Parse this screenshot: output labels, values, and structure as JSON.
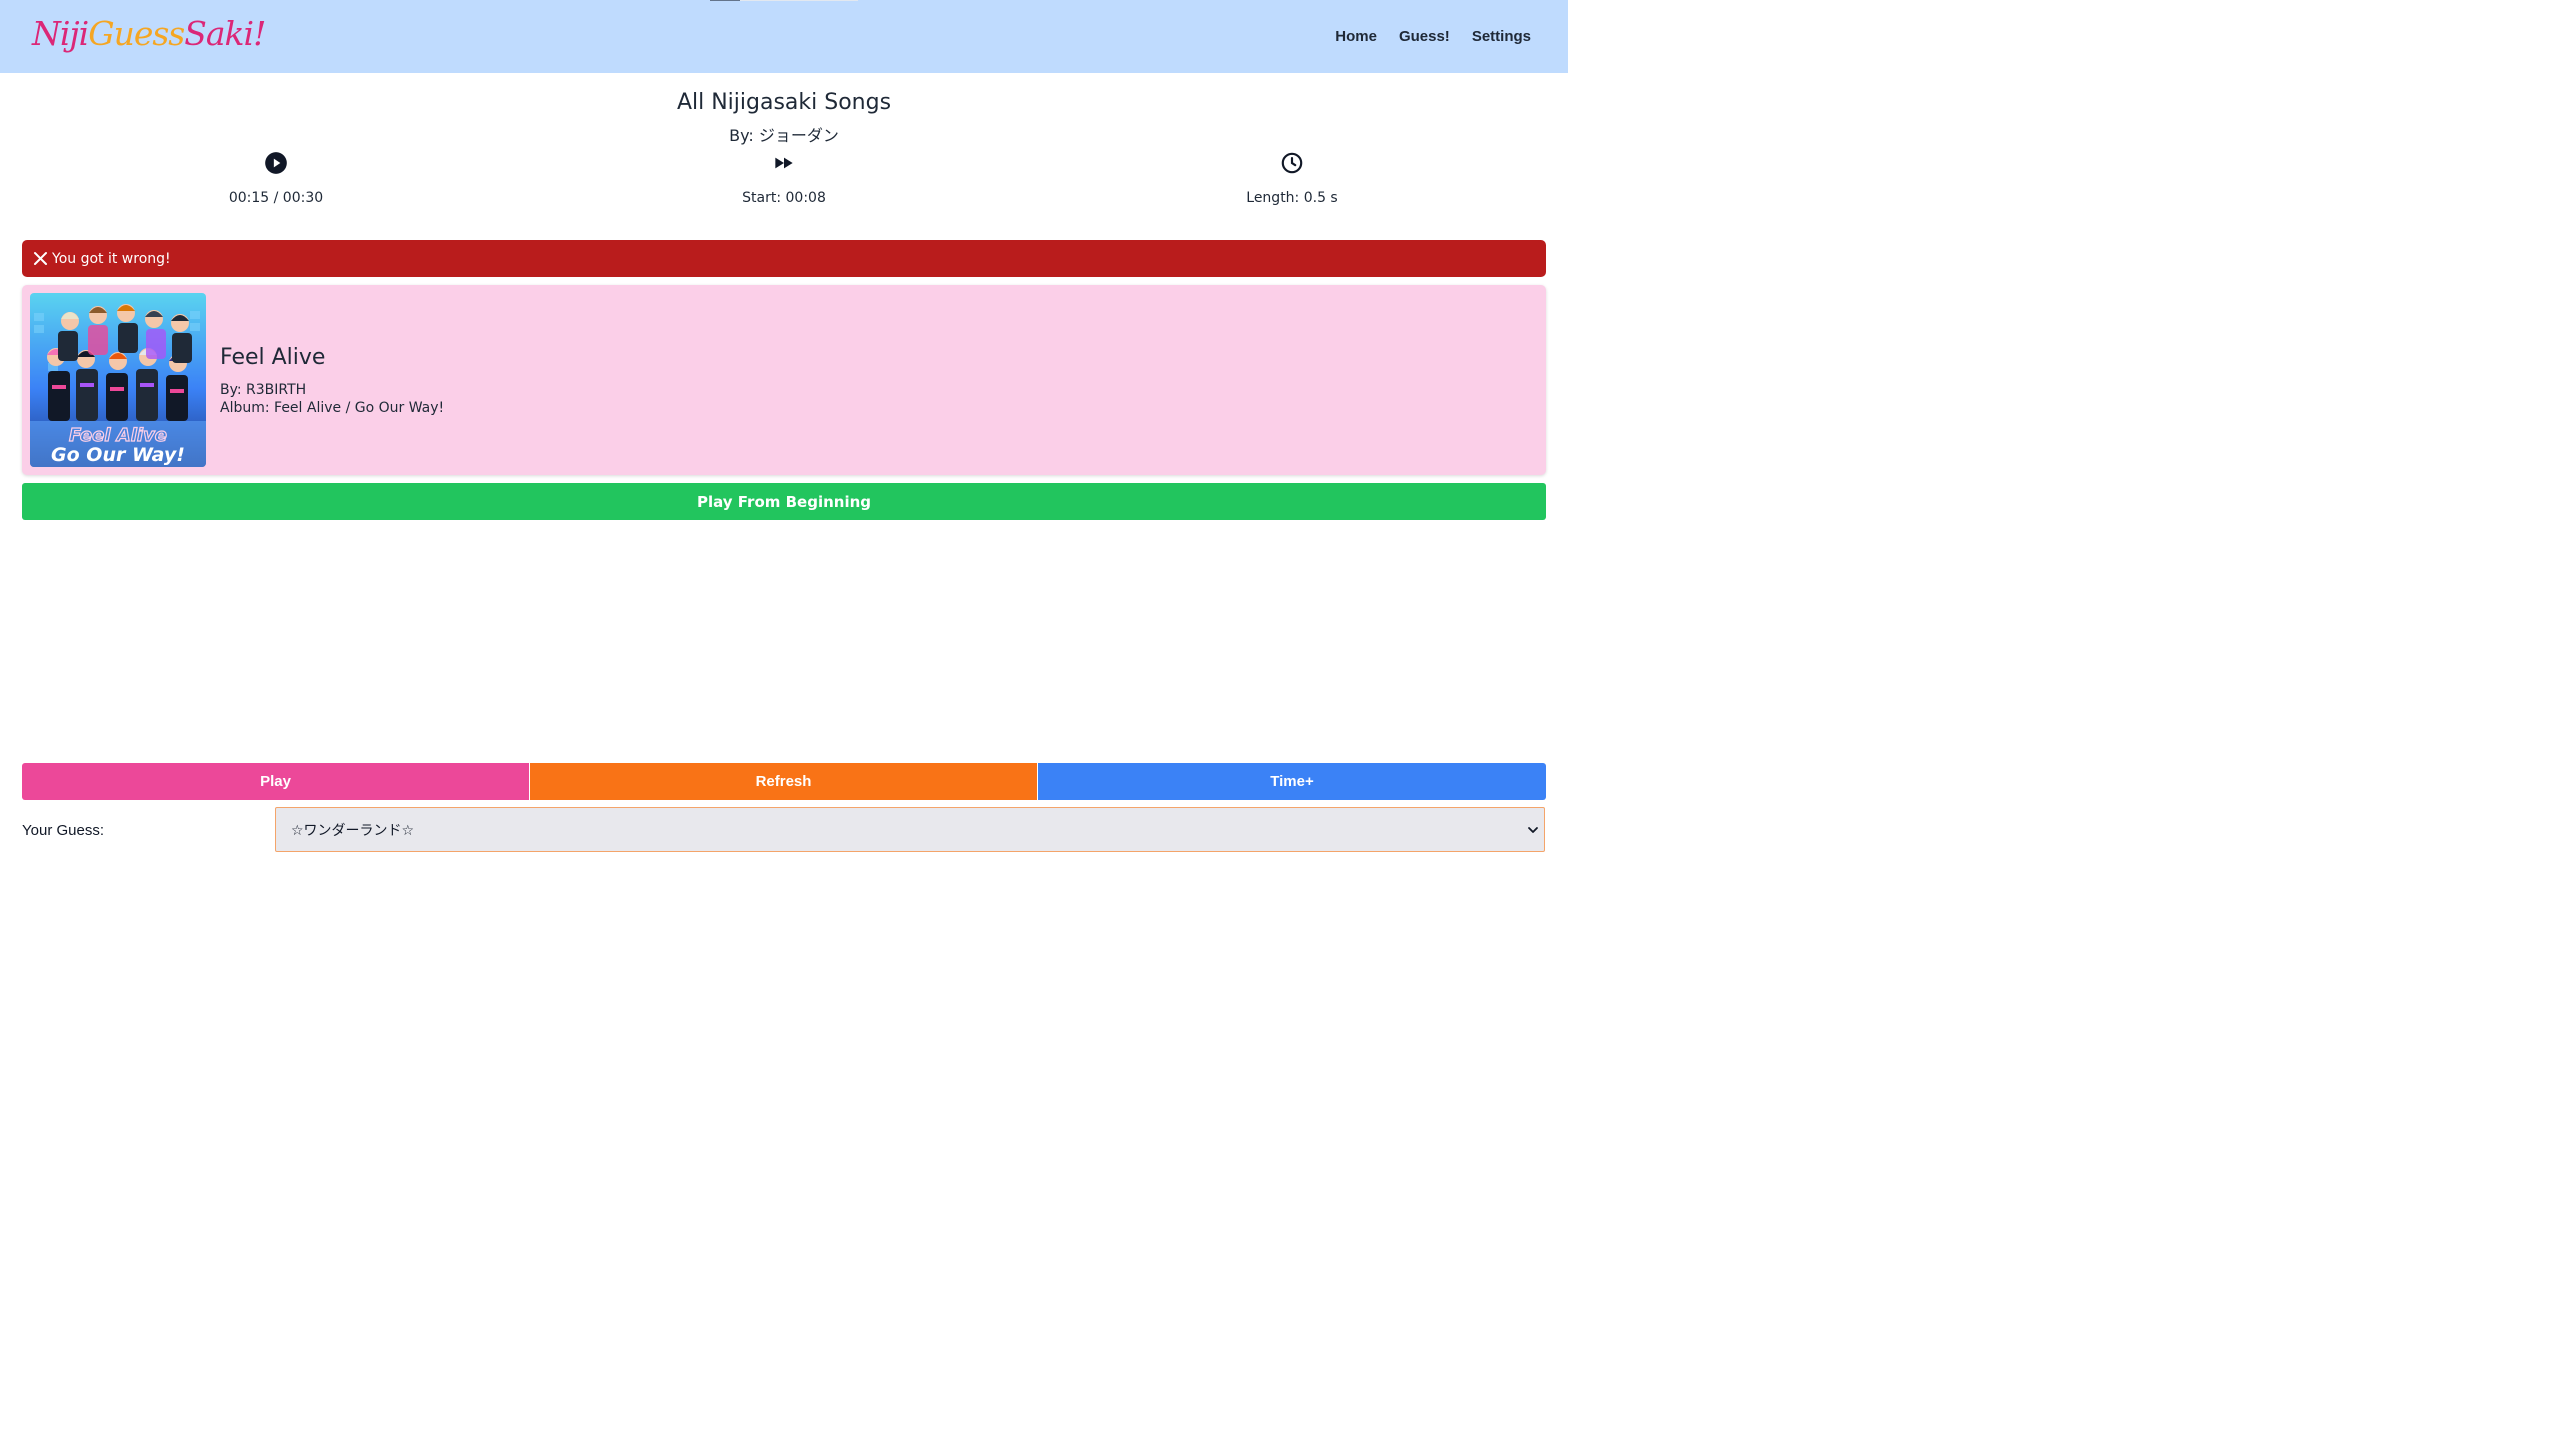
{
  "header": {
    "logo": {
      "part1": "Niji",
      "part2": "Guess",
      "part3": "Saki!"
    },
    "nav": [
      "Home",
      "Guess!",
      "Settings"
    ]
  },
  "quiz": {
    "title": "All Nijigasaki Songs",
    "author": "By: ジョーダン"
  },
  "stats": {
    "time_display": "00:15 / 00:30",
    "start_display": "Start: 00:08",
    "length_display": "Length: 0.5 s"
  },
  "result": {
    "message": "You got it wrong!",
    "color": "#b91c1c"
  },
  "song": {
    "title": "Feel Alive",
    "artist": "By: R3BIRTH",
    "album": "Album: Feel Alive / Go Our Way!",
    "cover_text": [
      "Feel Alive",
      "Go Our Way!"
    ]
  },
  "actions": {
    "play_from_beginning": "Play From Beginning",
    "play": "Play",
    "refresh": "Refresh",
    "time_plus": "Time+"
  },
  "guess": {
    "label": "Your Guess:",
    "selected": "☆ワンダーランド☆"
  },
  "colors": {
    "header_bg": "#bfdbfe",
    "play": "#ec4899",
    "refresh": "#f97316",
    "time_plus": "#3b82f6",
    "play_from_beginning": "#22c55e",
    "song_card": "#fbcfe8"
  }
}
